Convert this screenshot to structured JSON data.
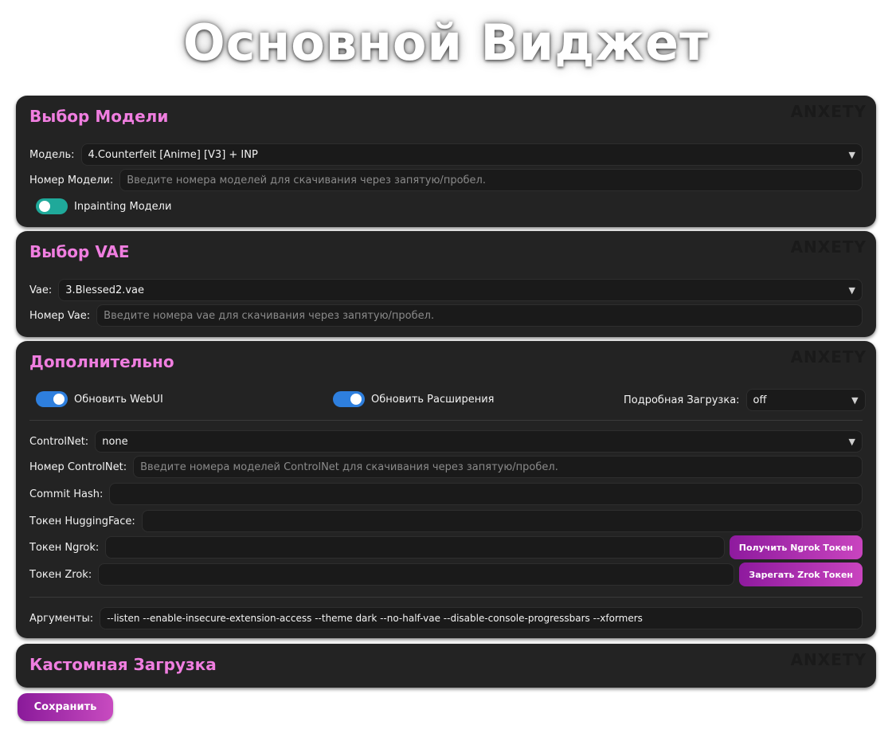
{
  "page_title": "Основной Виджет",
  "watermark": "ANXETY",
  "model_panel": {
    "title": "Выбор Модели",
    "model_label": "Модель:",
    "model_value": "4.Counterfeit [Anime] [V3] + INP",
    "number_label": "Номер Модели:",
    "number_placeholder": "Введите номера моделей для скачивания через запятую/пробел.",
    "inpainting_label": "Inpainting Модели",
    "inpainting_on": false
  },
  "vae_panel": {
    "title": "Выбор VAE",
    "vae_label": "Vae:",
    "vae_value": "3.Blessed2.vae",
    "number_label": "Номер Vae:",
    "number_placeholder": "Введите номера vae для скачивания через запятую/пробел."
  },
  "extra_panel": {
    "title": "Дополнительно",
    "update_webui_label": "Обновить WebUI",
    "update_webui_on": true,
    "update_ext_label": "Обновить Расширения",
    "update_ext_on": true,
    "detailed_label": "Подробная Загрузка:",
    "detailed_value": "off",
    "controlnet_label": "ControlNet:",
    "controlnet_value": "none",
    "controlnet_number_label": "Номер ControlNet:",
    "controlnet_number_placeholder": "Введите номера моделей ControlNet для скачивания через запятую/пробел.",
    "commit_label": "Commit Hash:",
    "commit_value": "",
    "hf_label": "Токен HuggingFace:",
    "hf_value": "",
    "ngrok_label": "Токен Ngrok:",
    "ngrok_value": "",
    "ngrok_button": "Получить Ngrok Токен",
    "zrok_label": "Токен Zrok:",
    "zrok_value": "",
    "zrok_button": "Зарегать Zrok Токен",
    "args_label": "Аргументы:",
    "args_value": "--listen --enable-insecure-extension-access --theme dark --no-half-vae --disable-console-progressbars --xformers"
  },
  "custom_panel": {
    "title": "Кастомная Загрузка"
  },
  "save_button": "Сохранить",
  "colors": {
    "accent_pink": "#f07ee0",
    "panel_bg": "#232323",
    "toggle_teal": "#1fa99a",
    "toggle_blue": "#2e7fde",
    "button_gradient_start": "#8e1a9e",
    "button_gradient_end": "#c944bf"
  }
}
